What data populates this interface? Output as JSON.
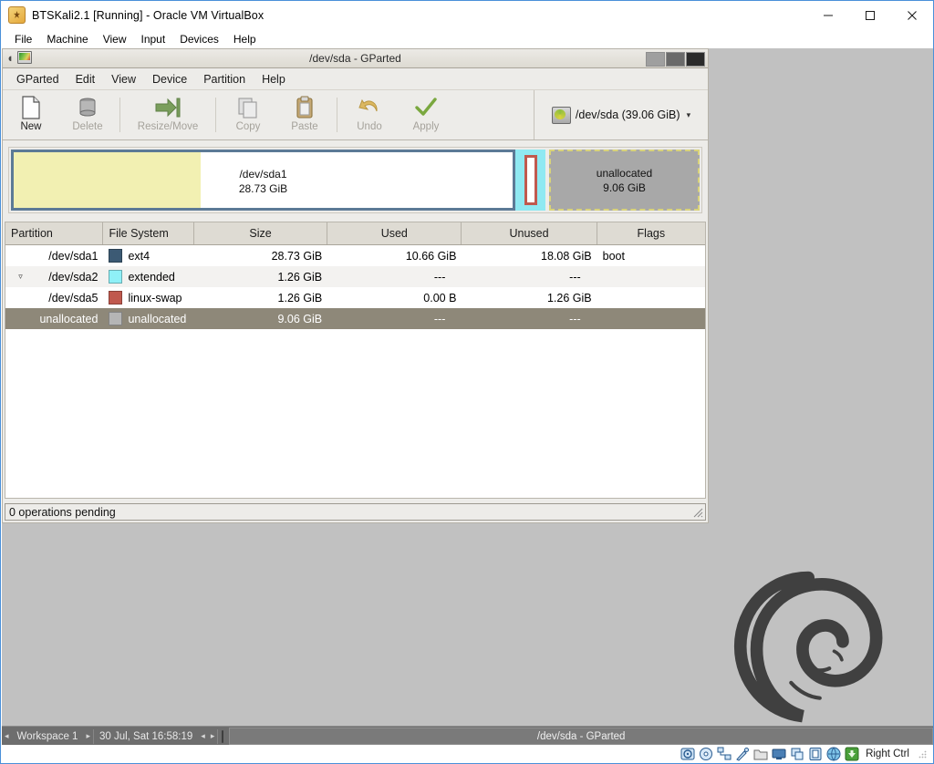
{
  "host_window": {
    "title": "BTSKali2.1 [Running] - Oracle VM VirtualBox",
    "app_icon": "virtualbox-icon",
    "menus": [
      "File",
      "Machine",
      "View",
      "Input",
      "Devices",
      "Help"
    ],
    "buttons": {
      "minimize": "minimize-icon",
      "maximize": "maximize-icon",
      "close": "close-icon"
    }
  },
  "gparted": {
    "title": "/dev/sda - GParted",
    "title_buttons": {
      "minimize": "minimize-button",
      "maximize": "maximize-button",
      "close": "close-button"
    },
    "menus": [
      "GParted",
      "Edit",
      "View",
      "Device",
      "Partition",
      "Help"
    ],
    "toolbar": [
      {
        "label": "New",
        "icon": "new-document-icon",
        "enabled": true
      },
      {
        "label": "Delete",
        "icon": "trash-icon",
        "enabled": false
      },
      {
        "label": "Resize/Move",
        "icon": "resize-arrow-icon",
        "enabled": false
      },
      {
        "label": "Copy",
        "icon": "copy-icon",
        "enabled": false
      },
      {
        "label": "Paste",
        "icon": "clipboard-paste-icon",
        "enabled": false
      },
      {
        "label": "Undo",
        "icon": "undo-arrow-icon",
        "enabled": false
      },
      {
        "label": "Apply",
        "icon": "checkmark-icon",
        "enabled": false
      }
    ],
    "device_selector": {
      "label": "/dev/sda  (39.06 GiB)",
      "icon": "harddisk-icon",
      "caret": "▾"
    },
    "graphic": {
      "sda1": {
        "name": "/dev/sda1",
        "size": "28.73 GiB",
        "fill_color": "#f2f0b2",
        "border_color": "#5c7a96"
      },
      "extended": {
        "name": "",
        "color": "#8fe9f2"
      },
      "swap": {
        "name": "",
        "border_color": "#c0594e"
      },
      "unallocated": {
        "name": "unallocated",
        "size": "9.06 GiB",
        "color": "#a8a8a8",
        "dash_color": "#d9d37a"
      }
    },
    "table": {
      "columns": [
        "Partition",
        "File System",
        "Size",
        "Used",
        "Unused",
        "Flags"
      ],
      "rows": [
        {
          "partition": "/dev/sda1",
          "filesystem": "ext4",
          "fs_color": "#3c5a74",
          "size": "28.73 GiB",
          "used": "10.66 GiB",
          "unused": "18.08 GiB",
          "flags": "boot",
          "indent": 1,
          "expander": "",
          "selected": false,
          "alt": false
        },
        {
          "partition": "/dev/sda2",
          "filesystem": "extended",
          "fs_color": "#8ff0f7",
          "size": "1.26 GiB",
          "used": "---",
          "unused": "---",
          "flags": "",
          "indent": 0,
          "expander": "▿",
          "selected": false,
          "alt": true
        },
        {
          "partition": "/dev/sda5",
          "filesystem": "linux-swap",
          "fs_color": "#c0594e",
          "size": "1.26 GiB",
          "used": "0.00 B",
          "unused": "1.26 GiB",
          "flags": "",
          "indent": 2,
          "expander": "",
          "selected": false,
          "alt": false
        },
        {
          "partition": "unallocated",
          "filesystem": "unallocated",
          "fs_color": "#b5b5b5",
          "size": "9.06 GiB",
          "used": "---",
          "unused": "---",
          "flags": "",
          "indent": 1,
          "expander": "",
          "selected": true,
          "alt": false
        }
      ]
    },
    "status": "0 operations pending"
  },
  "vm_taskbar": {
    "prev_workspace": "◂",
    "workspace": "Workspace 1",
    "next_workspace": "▸",
    "clock": "30 Jul, Sat 16:58:19",
    "left_arrow": "◂",
    "right_arrow": "▸",
    "window_icon": "gparted-window-icon",
    "task_button": "/dev/sda - GParted"
  },
  "vb_status": {
    "icons": [
      "harddisk-icon",
      "optical-disk-icon",
      "network-icon",
      "usb-icon",
      "shared-folder-icon",
      "display-icon",
      "remote-display-icon",
      "recording-icon",
      "virtualization-icon",
      "mouse-integration-icon"
    ],
    "host_key": "Right Ctrl",
    "grip": "resize-grip"
  },
  "desktop": {
    "background_color": "#c1c1c1",
    "logo": "debian-swirl-logo"
  }
}
